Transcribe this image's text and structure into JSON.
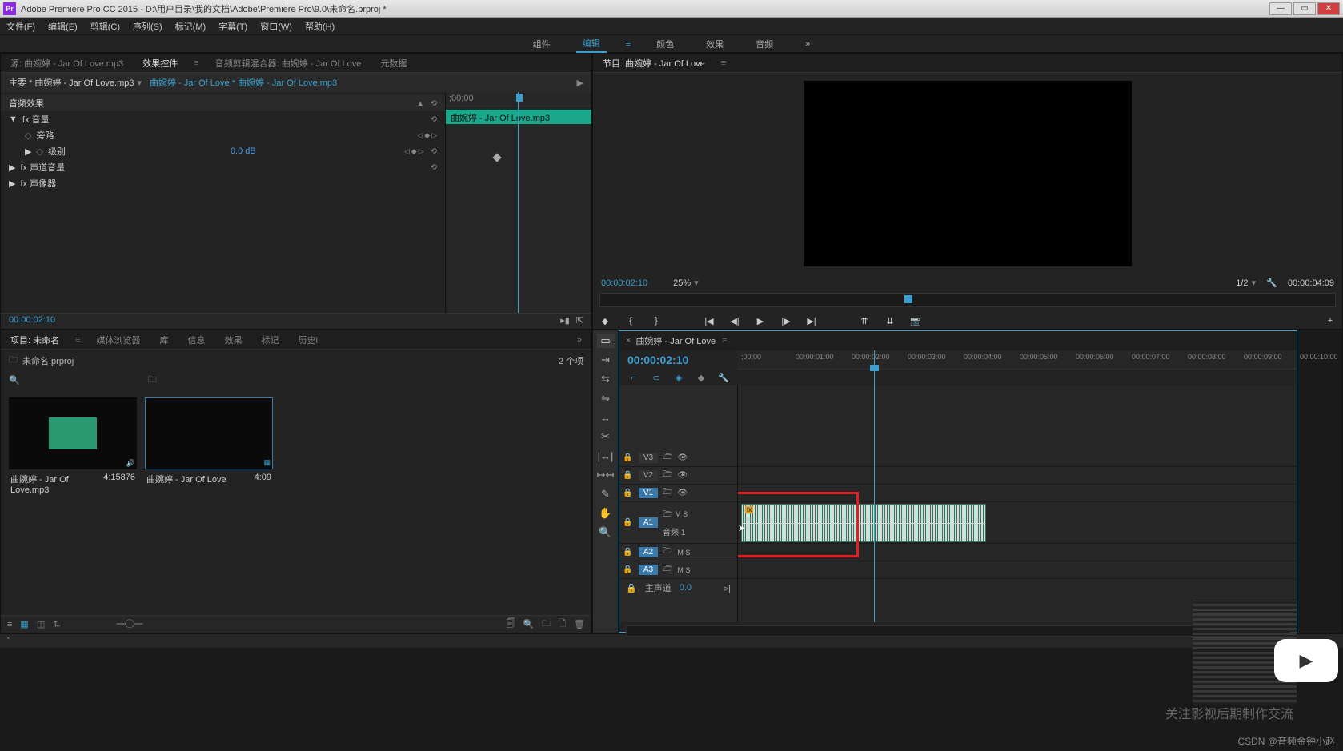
{
  "titlebar": {
    "icon_text": "Pr",
    "title": "Adobe Premiere Pro CC 2015 - D:\\用户目录\\我的文档\\Adobe\\Premiere Pro\\9.0\\未命名.prproj *"
  },
  "menubar": [
    "文件(F)",
    "编辑(E)",
    "剪辑(C)",
    "序列(S)",
    "标记(M)",
    "字幕(T)",
    "窗口(W)",
    "帮助(H)"
  ],
  "workspaces": {
    "items": [
      "组件",
      "编辑",
      "颜色",
      "效果",
      "音频"
    ],
    "active": "编辑",
    "more": "»"
  },
  "source_tabs": {
    "items": [
      "源: 曲婉婷 - Jar Of Love.mp3",
      "效果控件",
      "音频剪辑混合器: 曲婉婷 - Jar Of Love",
      "元数据"
    ],
    "active": "效果控件"
  },
  "effect_controls": {
    "master_label": "主要 * 曲婉婷 - Jar Of Love.mp3",
    "seq_link": "曲婉婷 - Jar Of Love * 曲婉婷 - Jar Of Love.mp3",
    "section_audio": "音频效果",
    "fx_volume": "fx 音量",
    "bypass": "旁路",
    "level": "级别",
    "level_value": "0.0 dB",
    "channel_vol": "fx 声道音量",
    "panner": "fx 声像器",
    "mini_ruler_start": ";00;00",
    "clip_label": "曲婉婷 - Jar Of Love.mp3",
    "timecode": "00:00:02:10"
  },
  "program": {
    "tab": "节目: 曲婉婷 - Jar Of Love",
    "timecode": "00:00:02:10",
    "zoom": "25%",
    "fit": "1/2",
    "duration": "00:00:04:09"
  },
  "project_tabs": {
    "items": [
      "项目: 未命名",
      "媒体浏览器",
      "库",
      "信息",
      "效果",
      "标记",
      "历史i"
    ],
    "active": "项目: 未命名",
    "more": "»"
  },
  "project": {
    "filename": "未命名.prproj",
    "count": "2 个项",
    "items": [
      {
        "name": "曲婉婷 - Jar Of Love.mp3",
        "dur": "4:15876"
      },
      {
        "name": "曲婉婷 - Jar Of Love",
        "dur": "4:09"
      }
    ]
  },
  "tools": [
    "selection",
    "track-select",
    "ripple",
    "rolling",
    "rate",
    "razor",
    "slip",
    "slide",
    "pen",
    "hand",
    "zoom"
  ],
  "timeline": {
    "seq_tab": "曲婉婷 - Jar Of Love",
    "timecode": "00:00:02:10",
    "ruler": [
      ";00;00",
      "00:00:01:00",
      "00:00:02:00",
      "00:00:03:00",
      "00:00:04:00",
      "00:00:05:00",
      "00:00:06:00",
      "00:00:07:00",
      "00:00:08:00",
      "00:00:09:00",
      "00:00:10:00"
    ],
    "tracks_v": [
      "V3",
      "V2",
      "V1"
    ],
    "tracks_a": [
      "A1",
      "A2",
      "A3"
    ],
    "a1_label": "音频 1",
    "ms": "M  S",
    "master": "主声道",
    "master_val": "0.0"
  },
  "overlay": {
    "caption": "关注影视后期制作交流",
    "watermark": "CSDN @音频金钟小赵"
  }
}
